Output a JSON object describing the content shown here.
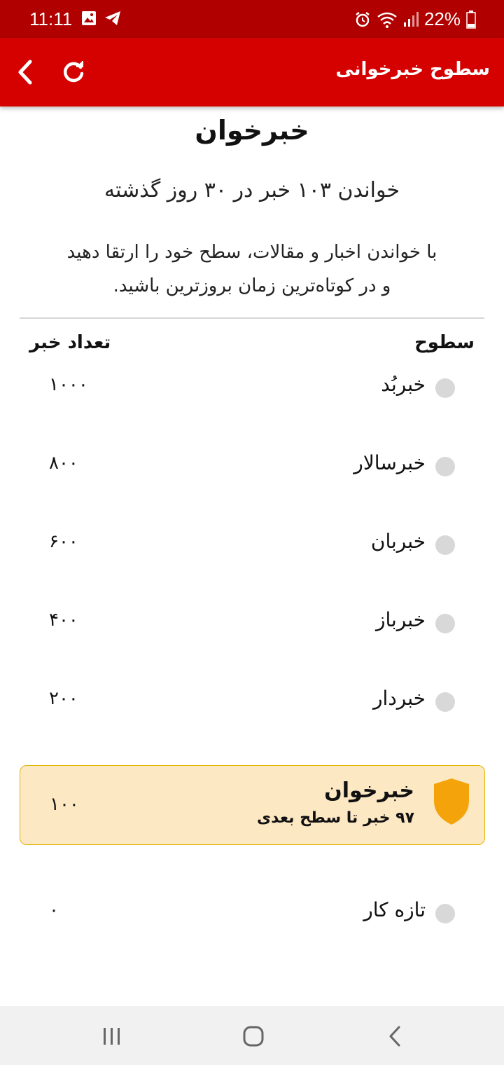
{
  "status_bar": {
    "time": "11:11",
    "battery": "22%",
    "left_icons": [
      "gallery-icon",
      "telegram-icon"
    ],
    "right_icons": [
      "alarm-icon",
      "wifi-icon",
      "signal-icon",
      "battery-icon"
    ]
  },
  "app_bar": {
    "title": "سطوح خبرخوانی",
    "back_icon": "chevron-left-icon",
    "refresh_icon": "refresh-icon",
    "color": "#d50000"
  },
  "header": {
    "current_level": "خبرخوان",
    "read_summary": "خواندن ۱۰۳ خبر در ۳۰ روز گذشته",
    "description_line1": "با خواندن اخبار و مقالات، سطح خود را ارتقا دهید",
    "description_line2": "و در کوتاه‌ترین زمان بروزترین باشید."
  },
  "table": {
    "col_levels": "سطوح",
    "col_count": "تعداد خبر",
    "levels": [
      {
        "name": "خبربُد",
        "count": "۱۰۰۰"
      },
      {
        "name": "خبرسالار",
        "count": "۸۰۰"
      },
      {
        "name": "خبربان",
        "count": "۶۰۰"
      },
      {
        "name": "خبرباز",
        "count": "۴۰۰"
      },
      {
        "name": "خبردار",
        "count": "۲۰۰"
      }
    ],
    "current": {
      "name": "خبرخوان",
      "next_info": "۹۷ خبر تا سطح بعدی",
      "count": "۱۰۰",
      "icon": "shield-icon",
      "accent": "#f5a30a"
    },
    "last": {
      "name": "تازه کار",
      "count": "۰"
    }
  },
  "nav_bar": {
    "recents_icon": "recents-icon",
    "home_icon": "home-icon",
    "back_icon": "back-icon"
  }
}
